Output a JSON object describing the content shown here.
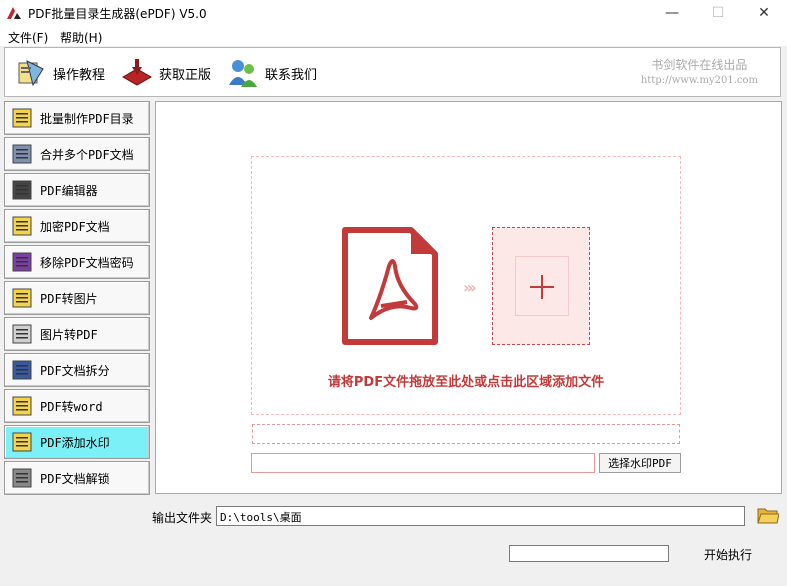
{
  "window": {
    "title": "PDF批量目录生成器(ePDF) V5.0",
    "minimize": "—",
    "maximize": "☐",
    "close": "✕"
  },
  "menu": {
    "file": "文件(F)",
    "help": "帮助(H)"
  },
  "toolbar": {
    "tutorial": "操作教程",
    "buy": "获取正版",
    "contact": "联系我们"
  },
  "brand": {
    "name": "书剑软件在线出品",
    "url": "http://www.my201.com"
  },
  "sidebar": {
    "items": [
      {
        "label": "批量制作PDF目录",
        "icon": "folder-list-icon"
      },
      {
        "label": "合并多个PDF文档",
        "icon": "merge-icon"
      },
      {
        "label": "PDF编辑器",
        "icon": "edit-icon"
      },
      {
        "label": "加密PDF文档",
        "icon": "lock-icon"
      },
      {
        "label": "移除PDF文档密码",
        "icon": "unlock-icon"
      },
      {
        "label": "PDF转图片",
        "icon": "image-icon"
      },
      {
        "label": "图片转PDF",
        "icon": "clip-icon"
      },
      {
        "label": "PDF文档拆分",
        "icon": "split-icon"
      },
      {
        "label": "PDF转word",
        "icon": "word-icon"
      },
      {
        "label": "PDF添加水印",
        "icon": "watermark-icon"
      },
      {
        "label": "PDF文档解锁",
        "icon": "keys-icon"
      }
    ],
    "active_index": 9
  },
  "dropzone": {
    "hint": "请将PDF文件拖放至此处或点击此区域添加文件",
    "arrows": "›››",
    "plus": "+"
  },
  "watermark": {
    "text_value": "",
    "image_path": "",
    "select_button": "选择水印PDF"
  },
  "output": {
    "label": "输出文件夹",
    "path": "D:\\tools\\桌面"
  },
  "progress": {
    "fraction": 0
  },
  "start": {
    "label": "开始执行"
  },
  "colors": {
    "accent": "#c23a3a",
    "active": "#7cf0f7"
  }
}
